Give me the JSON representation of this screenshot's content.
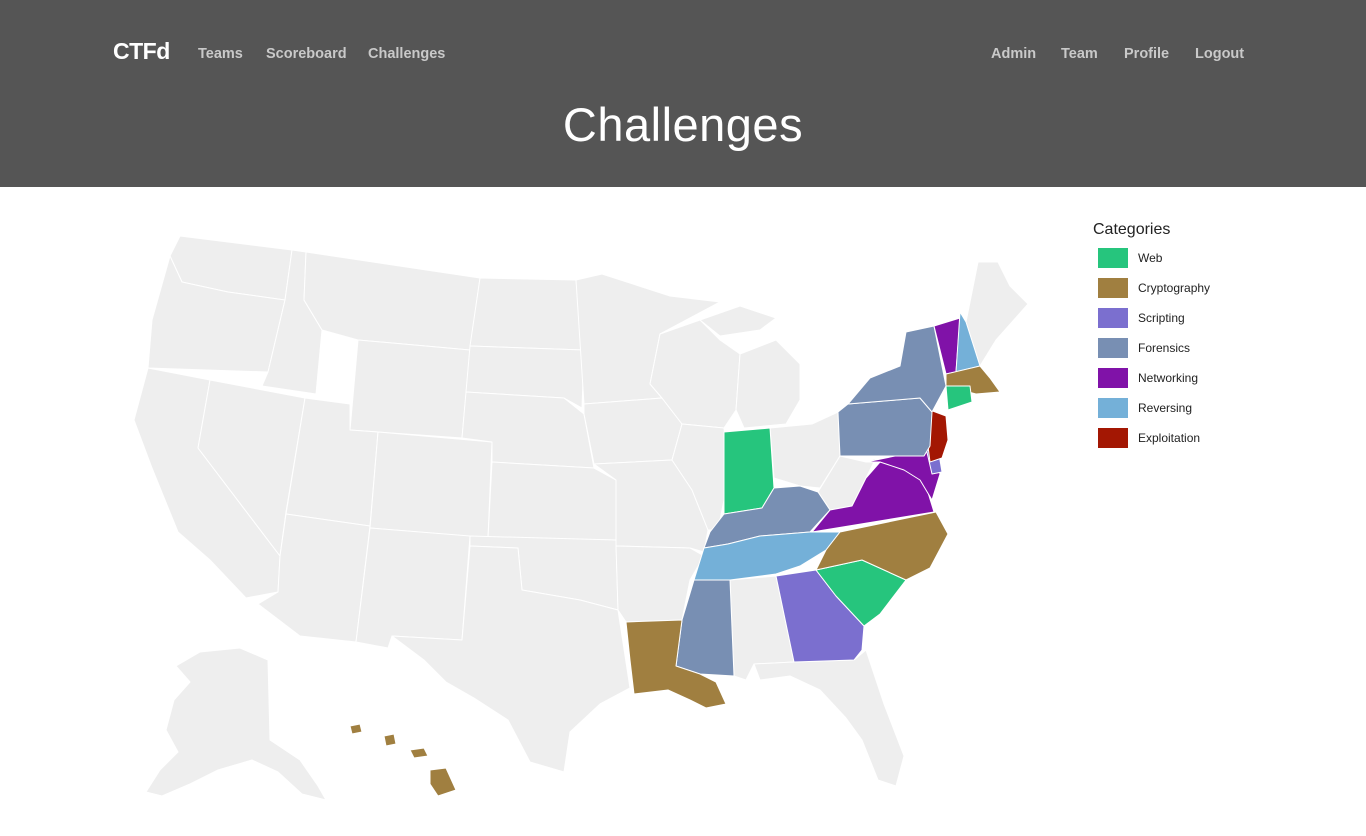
{
  "navbar": {
    "brand": "CTFd",
    "left_links": [
      "Teams",
      "Scoreboard",
      "Challenges"
    ],
    "right_links": [
      "Admin",
      "Team",
      "Profile",
      "Logout"
    ]
  },
  "page": {
    "title": "Challenges"
  },
  "legend": {
    "title": "Categories",
    "items": [
      {
        "label": "Web",
        "color": "#26c57d"
      },
      {
        "label": "Cryptography",
        "color": "#a07f40"
      },
      {
        "label": "Scripting",
        "color": "#7b6fcf"
      },
      {
        "label": "Forensics",
        "color": "#788fb3"
      },
      {
        "label": "Networking",
        "color": "#8012a8"
      },
      {
        "label": "Reversing",
        "color": "#74b0d8"
      },
      {
        "label": "Exploitation",
        "color": "#a31703"
      }
    ]
  },
  "map": {
    "default_color": "#eeeeee",
    "state_categories": {
      "indiana": "Web",
      "connecticut": "Web",
      "south-carolina": "Web",
      "massachusetts": "Cryptography",
      "north-carolina": "Cryptography",
      "louisiana": "Cryptography",
      "hawaii": "Cryptography",
      "georgia": "Scripting",
      "delaware": "Scripting",
      "new-york": "Forensics",
      "pennsylvania": "Forensics",
      "kentucky": "Forensics",
      "mississippi": "Forensics",
      "vermont": "Networking",
      "virginia": "Networking",
      "maryland": "Networking",
      "new-hampshire": "Reversing",
      "tennessee": "Reversing",
      "new-jersey": "Exploitation"
    }
  }
}
